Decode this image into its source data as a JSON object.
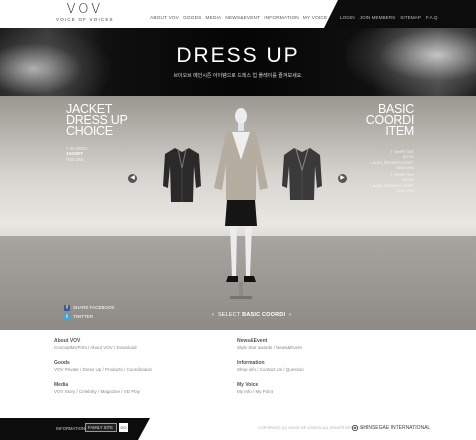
{
  "header": {
    "logo": "VOV",
    "logo_sub": "VOICE OF VOICES",
    "nav": [
      "ABOUT VOV",
      "GOODS",
      "MEDIA",
      "NEWS&EVENT",
      "INFORMATION",
      "MY VOICE"
    ],
    "util": [
      "LOGIN",
      "JOIN MEMBERS",
      "SITEMAP",
      "F.A.Q"
    ]
  },
  "hero": {
    "title": "DRESS UP",
    "subtitle": "브이오브 메인시즌 아이템으로 드레스 업 플레이를 즐겨보세요."
  },
  "stage": {
    "left_title": [
      "JACKET",
      "DRESS UP",
      "CHOICE"
    ],
    "left_items": [
      "V 03 00321",
      "JACKET",
      "VNS 4XX"
    ],
    "left_active_index": 1,
    "right_title": [
      "BASIC",
      "COORDI",
      "ITEM"
    ],
    "right_items": [
      "T SHIRT 00X",
      "50 XX",
      "LACEL BROKEN SHIRT",
      "1985 VNS",
      "T SHIRT 00X",
      "50 XX",
      "LACEL BROKEN SHIRT",
      "1985 VNS"
    ],
    "share": [
      {
        "icon": "facebook-icon",
        "label": "SHARE FACEBOOK",
        "color": "#3b5998"
      },
      {
        "icon": "twitter-icon",
        "label": "TWITTER",
        "color": "#33aadd"
      }
    ],
    "select_label": "SELECT",
    "select_value": "BASIC COORDI"
  },
  "footer_links": [
    {
      "title": "About VOV",
      "links": "ConceptMVPrint / About VOV / Download"
    },
    {
      "title": "Goods",
      "links": "VOV Private / Dress Up / Products / Coordination"
    },
    {
      "title": "Media",
      "links": "VOV Story / Celebrity / Magazine / VD Play"
    },
    {
      "title": "News&Event",
      "links": "Style Star awards / News&Event"
    },
    {
      "title": "Information",
      "links": "Shop info / Contact Us / Question"
    },
    {
      "title": "My Voice",
      "links": "My Info / My Point"
    }
  ],
  "bottom": {
    "info_label": "INFORMATION",
    "family_site": "FAMILY SITE",
    "go": "GO",
    "copyright": "COPYRIGHT (C) VOICE OF VOICES ALL RIGHTS RESERVED.",
    "brand": "SHINSEGAE INTERNATIONAL"
  }
}
